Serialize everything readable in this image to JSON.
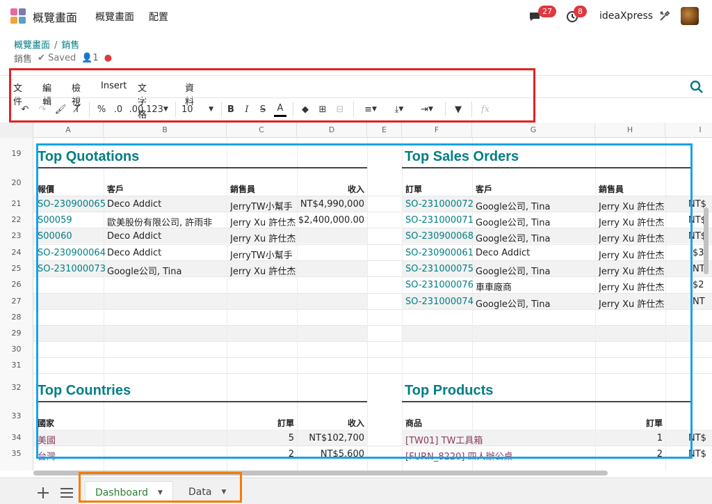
{
  "topnav": {
    "brand": "概覽畫面",
    "links": [
      "概覽畫面",
      "配置"
    ],
    "chat_count": "27",
    "activity_count": "8",
    "company": "ideaXpress"
  },
  "breadcrumb": {
    "root": "概覽畫面",
    "sep": "/",
    "current": "銷售"
  },
  "status": {
    "module": "銷售",
    "saved": "Saved",
    "users": "1"
  },
  "menu": [
    "文件",
    "編輯",
    "檢視",
    "Insert",
    "文字格式",
    "資料"
  ],
  "toolbar": {
    "percent": "%",
    "dec_less": ".0",
    "dec_more": ".00",
    "number_fmt": "123",
    "font_size": "10",
    "fx": "fx"
  },
  "columns": [
    "A",
    "B",
    "C",
    "D",
    "E",
    "F",
    "G",
    "H",
    "I"
  ],
  "rows": [
    "19",
    "20",
    "21",
    "22",
    "23",
    "24",
    "25",
    "26",
    "27",
    "28",
    "29",
    "30",
    "31",
    "32",
    "33",
    "34",
    "35"
  ],
  "quotations": {
    "title": "Top Quotations",
    "headers": [
      "報價",
      "客戶",
      "銷售員",
      "收入"
    ],
    "rows": [
      [
        "SO-230900065",
        "Deco Addict",
        "JerryTW小幫手",
        "NT$4,990,000"
      ],
      [
        "S00059",
        "歐美股份有限公司, 許雨非",
        "Jerry Xu 許仕杰",
        "$2,400,000.00"
      ],
      [
        "S00060",
        "Deco Addict",
        "Jerry Xu 許仕杰",
        ""
      ],
      [
        "SO-230900064",
        "Deco Addict",
        "JerryTW小幫手",
        ""
      ],
      [
        "SO-231000073",
        "Google公司, Tina",
        "Jerry Xu 許仕杰",
        ""
      ]
    ]
  },
  "sales_orders": {
    "title": "Top Sales Orders",
    "headers": [
      "訂單",
      "客戶",
      "銷售員"
    ],
    "rows": [
      [
        "SO-231000072",
        "Google公司, Tina",
        "Jerry Xu 許仕杰",
        "NT$"
      ],
      [
        "SO-231000071",
        "Google公司, Tina",
        "Jerry Xu 許仕杰",
        "NT$"
      ],
      [
        "SO-230900068",
        "Google公司, Tina",
        "Jerry Xu 許仕杰",
        "NT$"
      ],
      [
        "SO-230900061",
        "Deco Addict",
        "Jerry Xu 許仕杰",
        "$3"
      ],
      [
        "SO-231000075",
        "Google公司, Tina",
        "Jerry Xu 許仕杰",
        "NT"
      ],
      [
        "SO-231000076",
        "車車廠商",
        "Jerry Xu 許仕杰",
        "$2"
      ],
      [
        "SO-231000074",
        "Google公司, Tina",
        "Jerry Xu 許仕杰",
        "NT"
      ]
    ]
  },
  "countries": {
    "title": "Top Countries",
    "headers": [
      "國家",
      "訂單",
      "收入"
    ],
    "rows": [
      [
        "美國",
        "5",
        "NT$102,700"
      ],
      [
        "台灣",
        "2",
        "NT$5,600"
      ]
    ]
  },
  "products": {
    "title": "Top Products",
    "headers": [
      "商品",
      "訂單"
    ],
    "rows": [
      [
        "[TW01] TW工具箱",
        "1",
        "NT$"
      ],
      [
        "[FURN_8220] 四人辦公桌",
        "2",
        "NT$"
      ]
    ]
  },
  "sheets": [
    {
      "label": "Dashboard",
      "active": true
    },
    {
      "label": "Data",
      "active": false
    }
  ],
  "colors": {
    "accent": "#017e84",
    "product_link": "#873c5e",
    "red_box": "#e02222",
    "blue_box": "#17a2e8",
    "orange_box": "#f57c00",
    "active_tab": "#2e7d32"
  }
}
